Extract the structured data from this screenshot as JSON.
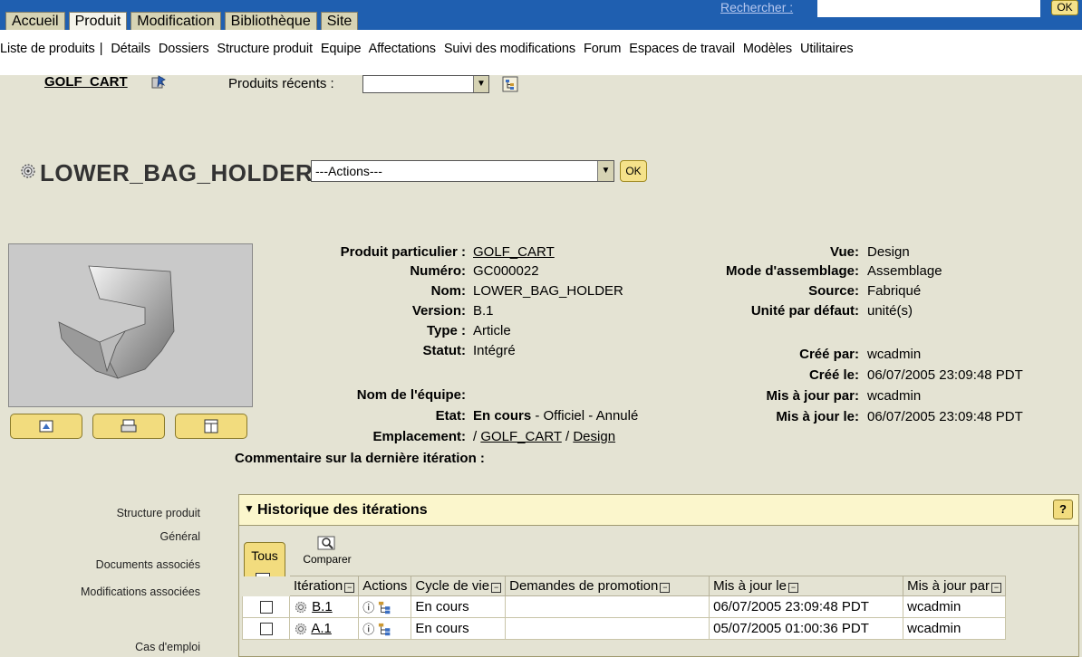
{
  "top_tabs": [
    "Accueil",
    "Produit",
    "Modification",
    "Bibliothèque",
    "Site"
  ],
  "top_active_tab": "Produit",
  "search": {
    "label": "Rechercher :",
    "value": "",
    "ok_label": "OK"
  },
  "subnav": [
    "Liste de produits",
    "|",
    "Détails",
    "Dossiers",
    "Structure produit",
    "Equipe",
    "Affectations",
    "Suivi des modifications",
    "Forum",
    "Espaces de travail",
    "Modèles",
    "Utilitaires"
  ],
  "product_bar": {
    "product_link": "GOLF_CART",
    "recent_label": "Produits récents :",
    "recent_value": ""
  },
  "part": {
    "title": "LOWER_BAG_HOLDER",
    "actions_value": "---Actions---",
    "actions_ok": "OK"
  },
  "attrs_left": [
    {
      "label": "Produit particulier :",
      "value": "GOLF_CART",
      "link": true
    },
    {
      "label": "Numéro:",
      "value": "GC000022"
    },
    {
      "label": "Nom:",
      "value": "LOWER_BAG_HOLDER"
    },
    {
      "label": "Version:",
      "value": "B.1"
    },
    {
      "label": "Type :",
      "value": "Article"
    },
    {
      "label": "Statut:",
      "value": "Intégré"
    }
  ],
  "attrs_left2": {
    "team_label": "Nom de l'équipe:",
    "team_value": "",
    "state_label": "Etat:",
    "state_current": "En cours",
    "state_rest": " - Officiel - Annulé",
    "location_label": "Emplacement:",
    "location_sep1": "/",
    "location_part1": "GOLF_CART",
    "location_sep2": "/",
    "location_part2": "Design",
    "comment_label": "Commentaire sur la dernière itération :"
  },
  "attrs_right": [
    {
      "label": "Vue:",
      "value": "Design"
    },
    {
      "label": "Mode d'assemblage:",
      "value": "Assemblage"
    },
    {
      "label": "Source:",
      "value": "Fabriqué"
    },
    {
      "label": "Unité par défaut:",
      "value": "unité(s)"
    }
  ],
  "attrs_right2": [
    {
      "label": "Créé par:",
      "value": "wcadmin"
    },
    {
      "label": "Créé le:",
      "value": "06/07/2005 23:09:48 PDT"
    },
    {
      "label": "Mis à jour par:",
      "value": "wcadmin"
    },
    {
      "label": "Mis à jour le:",
      "value": "06/07/2005 23:09:48 PDT"
    }
  ],
  "side_links": [
    "Structure produit",
    "Général",
    "Documents associés",
    "Modifications associées",
    "Cas d'emploi"
  ],
  "iterations": {
    "title": "Historique des itérations",
    "help": "?",
    "tous_label": "Tous",
    "compare_label": "Comparer",
    "columns": [
      "Itération",
      "Actions",
      "Cycle de vie",
      "Demandes de promotion",
      "Mis à jour le",
      "Mis à jour par"
    ],
    "rows": [
      {
        "iteration": "B.1",
        "lifecycle": "En cours",
        "promo": "",
        "updated": "06/07/2005 23:09:48 PDT",
        "by": "wcadmin"
      },
      {
        "iteration": "A.1",
        "lifecycle": "En cours",
        "promo": "",
        "updated": "05/07/2005 01:00:36 PDT",
        "by": "wcadmin"
      }
    ]
  },
  "colors": {
    "top_bar": "#1f5fb0",
    "background": "#e4e3d3",
    "button_yellow": "#f2dc7e",
    "panel_header": "#fbf6cc"
  }
}
